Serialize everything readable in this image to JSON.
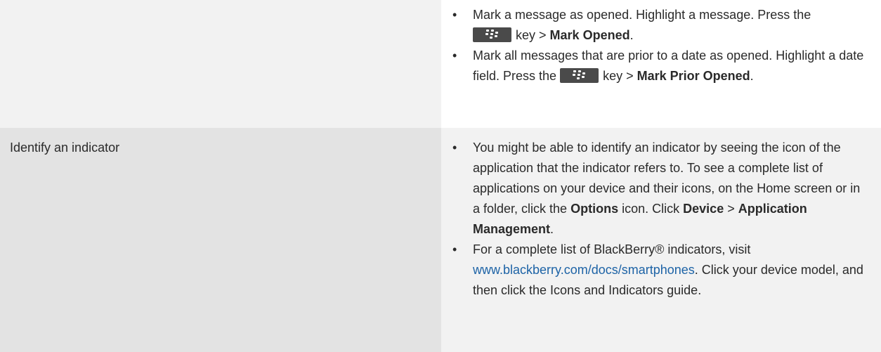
{
  "table": {
    "row1": {
      "left": "",
      "bullets": [
        {
          "pre": "Mark a message as opened. Highlight a message. Press the",
          "key_icon": "blackberry-menu-key-icon",
          "mid": "key >",
          "bold": "Mark Opened",
          "post": "."
        },
        {
          "pre": "Mark all messages that are prior to a date as opened. Highlight a date field. Press the",
          "key_icon": "blackberry-menu-key-icon",
          "mid": "key >",
          "bold": "Mark Prior Opened",
          "post": "."
        }
      ]
    },
    "row2": {
      "left": "Identify an indicator",
      "bullet1": {
        "t1": "You might be able to identify an indicator by seeing the icon of the application that the indicator refers to. To see a complete list of applications on your device and their icons, on the Home screen or in a folder, click the",
        "b1": "Options",
        "t2": "icon. Click",
        "b2": "Device",
        "t3": ">",
        "b3": "Application Management",
        "t4": "."
      },
      "bullet2": {
        "t1": "For a complete list of BlackBerry® indicators, visit",
        "link": "www.blackberry.com/docs/smartphones",
        "t2": ". Click your device model, and then click the Icons and Indicators guide."
      }
    }
  },
  "colors": {
    "link": "#1d63a6",
    "row_shade_light": "#f2f2f2",
    "row_shade_dark": "#e3e3e3",
    "menu_key": "#4a4a4a"
  }
}
